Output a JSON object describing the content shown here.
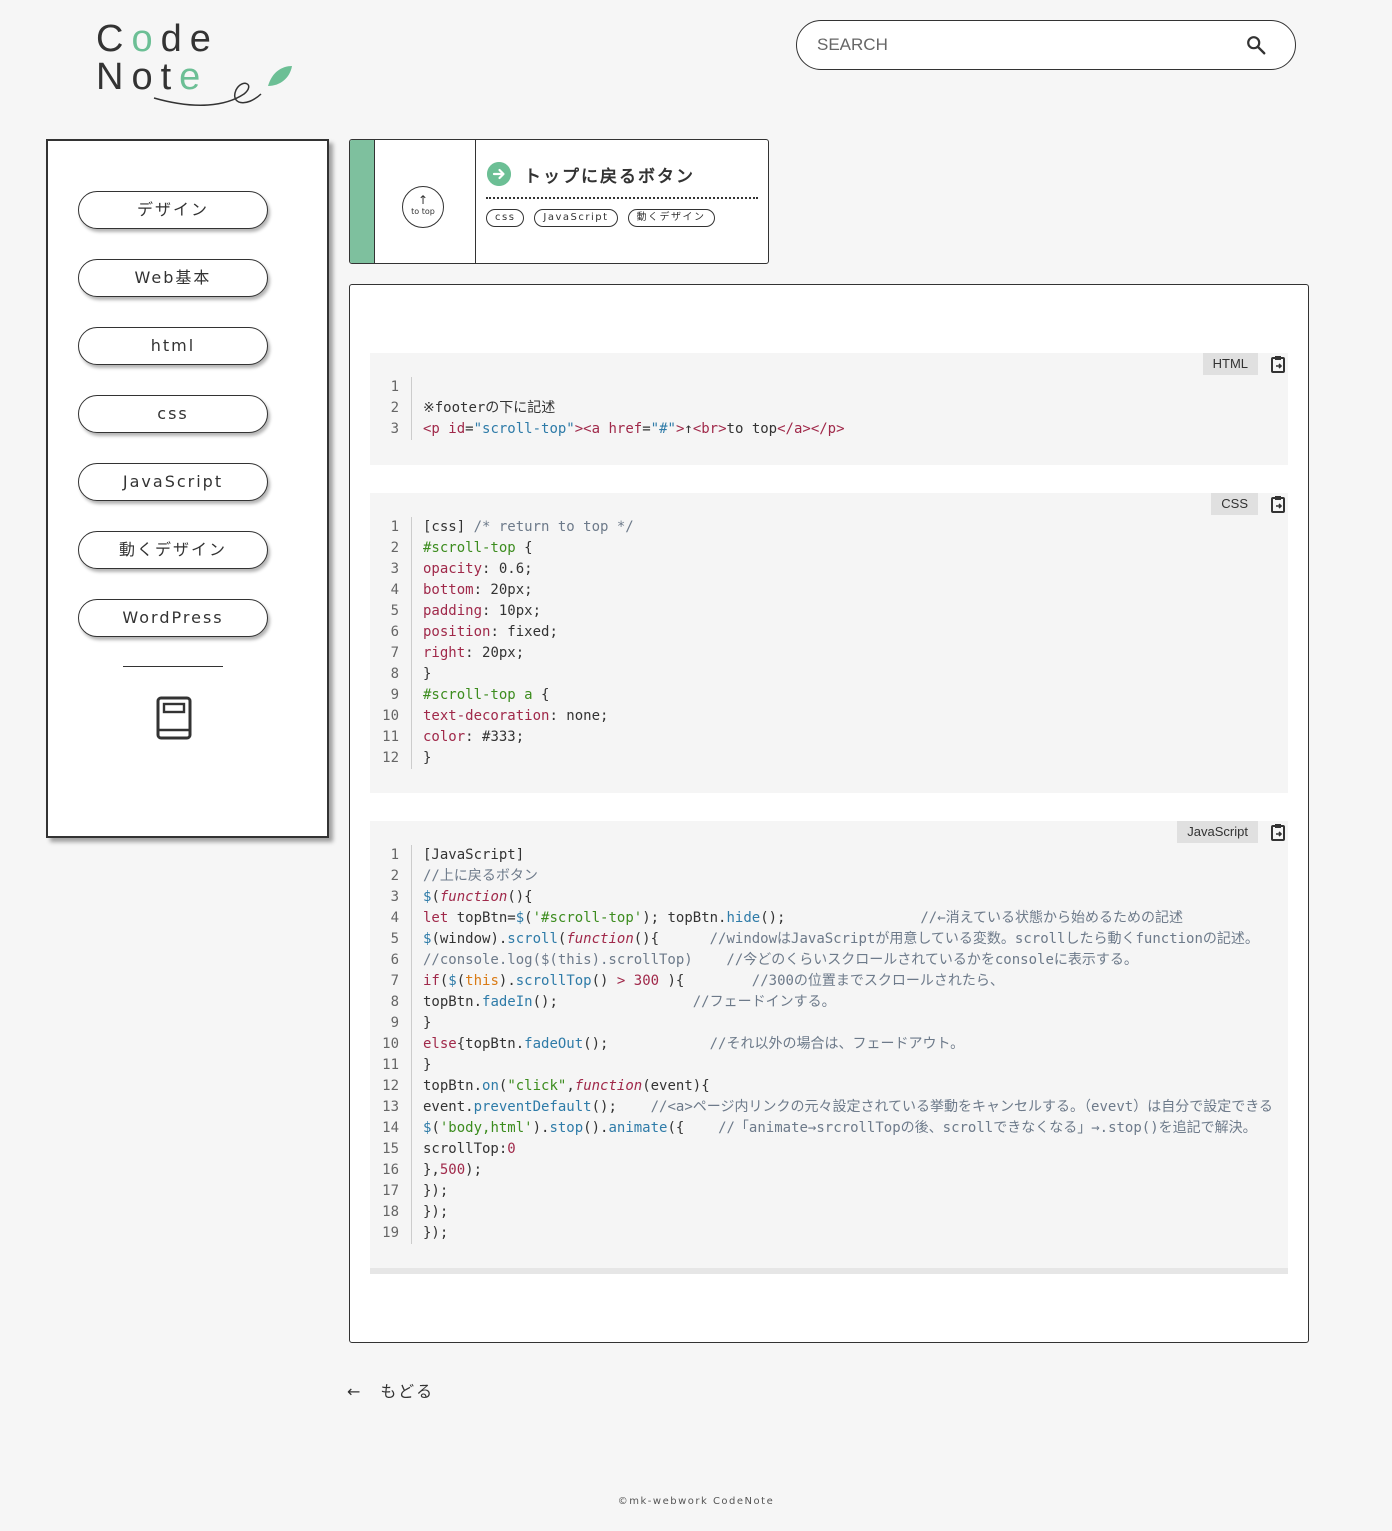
{
  "logo": {
    "line1_a": "C",
    "line1_b": "o",
    "line1_c": "de",
    "line2_a": "Not",
    "line2_b": "e"
  },
  "search": {
    "placeholder": "SEARCH"
  },
  "sidebar": {
    "items": [
      {
        "label": "デザイン"
      },
      {
        "label": "Web基本"
      },
      {
        "label": "html"
      },
      {
        "label": "css"
      },
      {
        "label": "JavaScript"
      },
      {
        "label": "動くデザイン"
      },
      {
        "label": "WordPress"
      }
    ]
  },
  "card": {
    "thumb_arrow": "↑",
    "thumb_text": "to top",
    "title": "トップに戻るボタン",
    "tags": [
      "css",
      "JavaScript",
      "動くデザイン"
    ]
  },
  "blocks": {
    "html": {
      "lang": "HTML"
    },
    "css": {
      "lang": "CSS"
    },
    "js": {
      "lang": "JavaScript"
    }
  },
  "back": {
    "arrow": "←",
    "label": "もどる"
  },
  "footer": {
    "text": "©mk-webwork CodeNote"
  },
  "colors": {
    "accent": "#6cbf95",
    "bar": "#7ec09e"
  }
}
